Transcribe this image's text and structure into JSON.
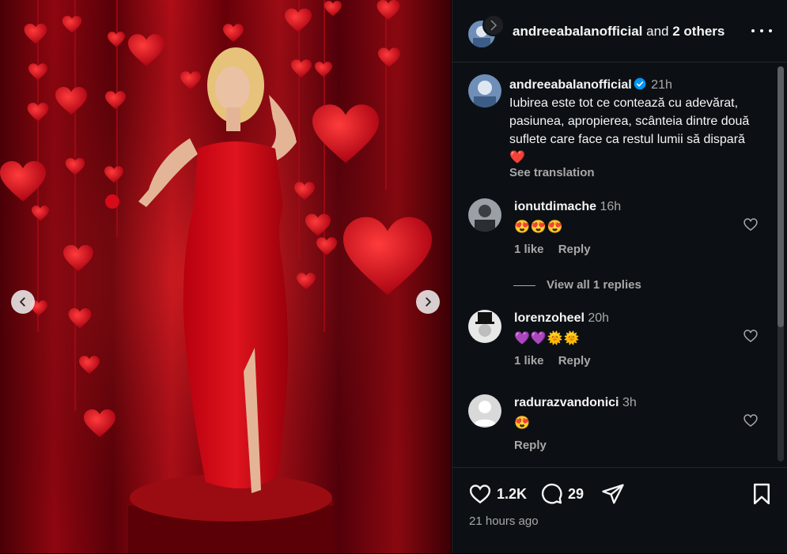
{
  "header": {
    "username": "andreeabalanofficial",
    "and_text": "and",
    "others": "2 others"
  },
  "caption": {
    "username": "andreeabalanofficial",
    "time": "21h",
    "text": "Iubirea este tot ce contează cu adevărat, pasiunea, apropierea, scânteia dintre două suflete care face ca restul lumii să dispară ❤️",
    "see_translation": "See translation"
  },
  "comments": [
    {
      "username": "ionutdimache",
      "time": "16h",
      "text": "😍😍😍",
      "likes": "1 like",
      "reply": "Reply"
    },
    {
      "username": "lorenzoheel",
      "time": "20h",
      "text": "💜💜🌞🌞",
      "likes": "1 like",
      "reply": "Reply"
    },
    {
      "username": "radurazvandonici",
      "time": "3h",
      "text": "😍",
      "likes": "",
      "reply": "Reply"
    }
  ],
  "view_replies": "View all 1 replies",
  "actions": {
    "likes": "1.2K",
    "comments": "29"
  },
  "timestamp": "21 hours ago",
  "icons": {
    "nav_prev": "chevron-left-icon",
    "nav_next": "chevron-right-icon",
    "more": "more-horizontal-icon",
    "verified": "verified-badge-icon",
    "heart": "heart-icon",
    "comment": "comment-icon",
    "share": "share-icon",
    "save": "bookmark-icon"
  },
  "colors": {
    "panel_bg": "#0c1014",
    "verified": "#0095f6",
    "muted_text": "#a8a8a8",
    "photo_red": "#c8101c"
  }
}
